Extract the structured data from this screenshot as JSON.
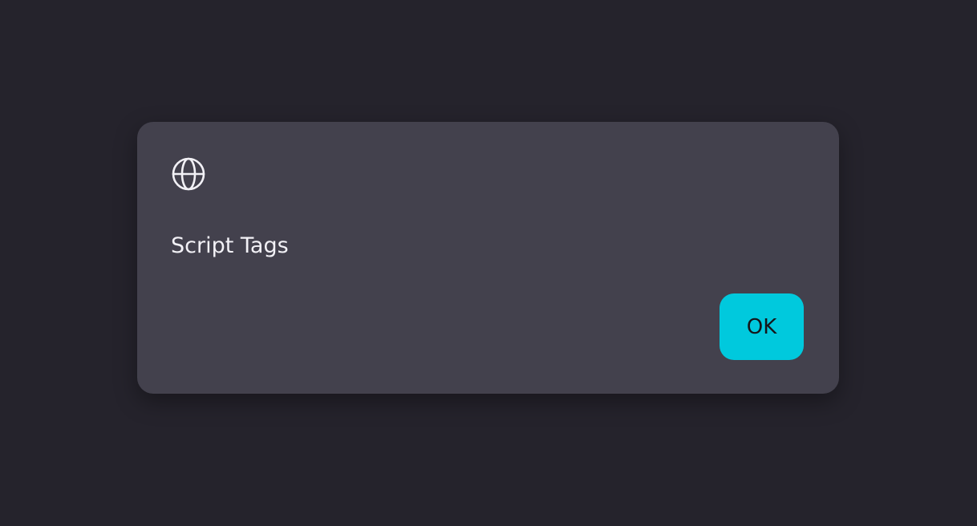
{
  "dialog": {
    "icon": "globe-icon",
    "message": "Script Tags",
    "ok_label": "OK"
  },
  "colors": {
    "background": "#25232c",
    "dialog_surface": "#43414d",
    "text": "#f2f1f6",
    "accent": "#00c9dd",
    "accent_text": "#15161a"
  }
}
